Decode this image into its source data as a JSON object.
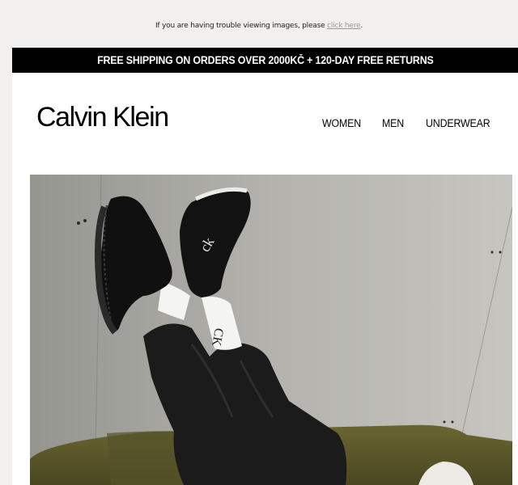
{
  "preheader": {
    "text": "If you are having trouble viewing images, please ",
    "link_label": "click here",
    "suffix": "."
  },
  "banner": {
    "text": "FREE SHIPPING ON ORDERS OVER 2000KČ + 120-DAY FREE RETURNS"
  },
  "brand": {
    "logo_text": "Calvin Klein"
  },
  "nav": {
    "items": [
      {
        "label": "WOMEN"
      },
      {
        "label": "MEN"
      },
      {
        "label": "UNDERWEAR"
      }
    ]
  },
  "hero": {
    "image_icon": "hero-photo-sneakers",
    "sock_logo": "CK",
    "colors": {
      "wall": "#b4b3ae",
      "sofa": "#5d5a2c",
      "shoe": "#111111",
      "trousers": "#1a1a1a",
      "sock": "#f4f4f2"
    }
  }
}
